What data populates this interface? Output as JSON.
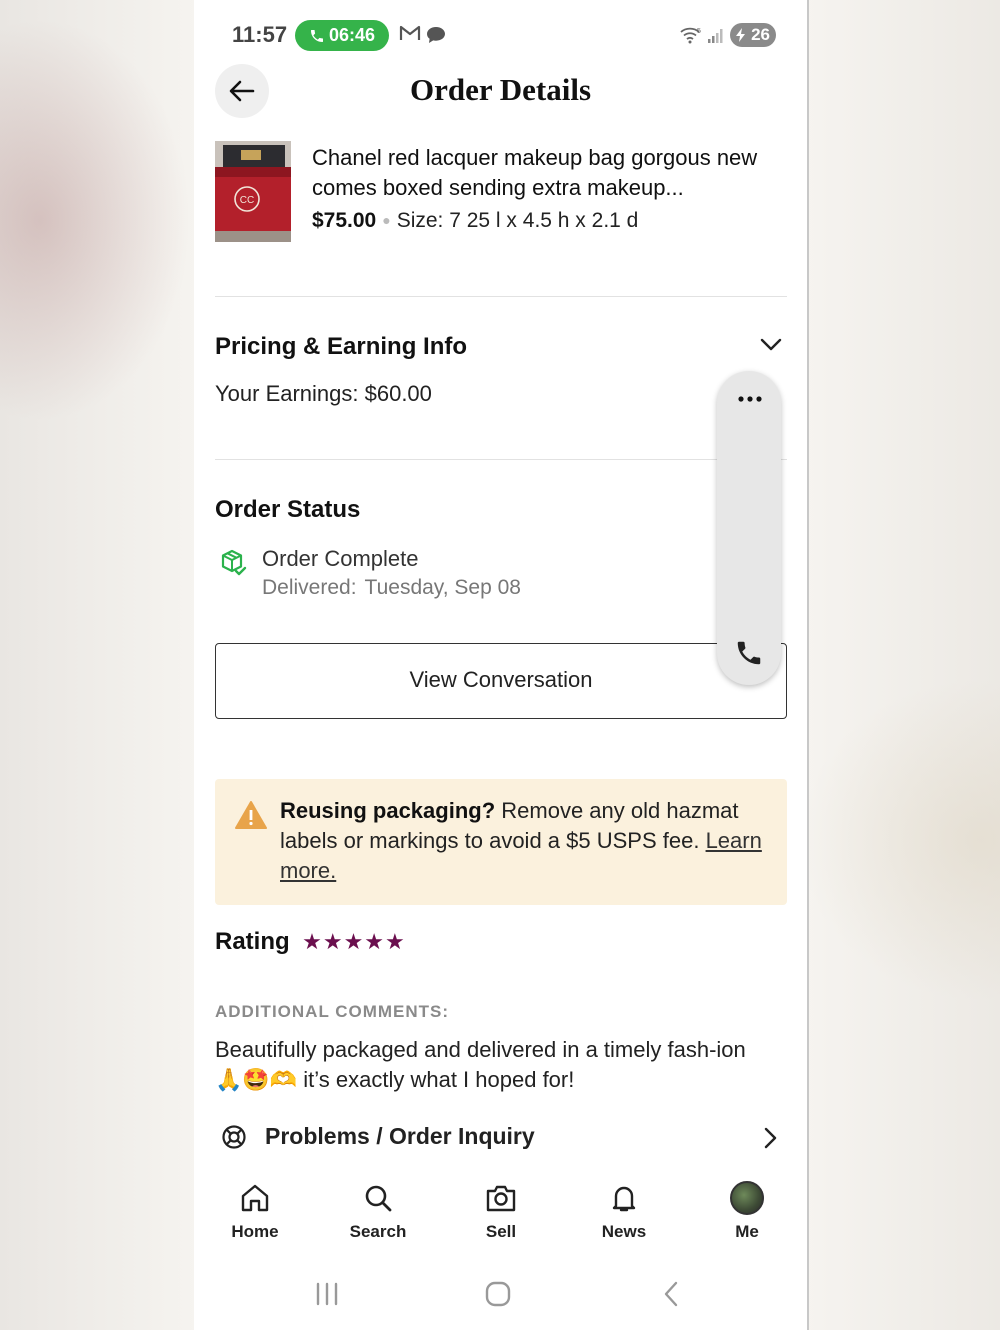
{
  "status_bar": {
    "time": "11:57",
    "call_timer": "06:46",
    "battery": "26",
    "icons": [
      "phone-icon",
      "gmail-icon",
      "chat-icon",
      "wifi-icon",
      "signal-icon",
      "battery-icon"
    ]
  },
  "header": {
    "title": "Order Details",
    "back_icon": "arrow-left-icon"
  },
  "product": {
    "title": "Chanel red lacquer makeup bag gorgous new comes boxed sending extra makeup...",
    "price": "$75.00",
    "size": "Size: 7 25 l x 4.5 h x 2.1 d"
  },
  "pricing": {
    "title": "Pricing & Earning Info",
    "earnings": "Your Earnings: $60.00"
  },
  "order_status": {
    "title": "Order Status",
    "status": "Order Complete",
    "delivered_label": "Delivered:",
    "delivered_date": "Tuesday, Sep 08",
    "view_conversation": "View Conversation"
  },
  "notice": {
    "bold": "Reusing packaging?",
    "text": " Remove any old hazmat labels or markings to avoid a $5 USPS fee. ",
    "link": "Learn more."
  },
  "rating": {
    "label": "Rating",
    "stars": 5,
    "stars_display": "★★★★★"
  },
  "comments": {
    "label": "ADDITIONAL COMMENTS:",
    "text": "Beautifully packaged and delivered in a timely fash-ion 🙏🤩🫶 it’s exactly what I hoped for!"
  },
  "problems": {
    "label": "Problems / Order Inquiry"
  },
  "bottom_nav": {
    "items": [
      {
        "label": "Home",
        "icon": "home-icon"
      },
      {
        "label": "Search",
        "icon": "search-icon"
      },
      {
        "label": "Sell",
        "icon": "camera-icon"
      },
      {
        "label": "News",
        "icon": "bell-icon"
      },
      {
        "label": "Me",
        "icon": "avatar"
      }
    ]
  },
  "colors": {
    "call_green": "#35b34a",
    "star_color": "#6b0f4e",
    "notice_bg": "#fbf1dd",
    "warn_orange": "#e8a44a",
    "status_green": "#2bb24c"
  }
}
